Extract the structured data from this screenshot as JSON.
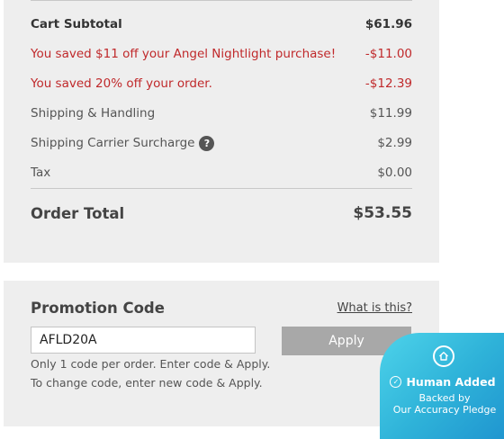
{
  "summary": {
    "subtotal": {
      "label": "Cart Subtotal",
      "value": "$61.96"
    },
    "discounts": [
      {
        "label": "You saved $11 off your Angel Nightlight purchase!",
        "value": "-$11.00"
      },
      {
        "label": "You saved 20% off your order.",
        "value": "-$12.39"
      }
    ],
    "shipping": {
      "label": "Shipping & Handling",
      "value": "$11.99"
    },
    "surcharge": {
      "label": "Shipping Carrier Surcharge",
      "value": "$2.99",
      "help_glyph": "?"
    },
    "tax": {
      "label": "Tax",
      "value": "$0.00"
    },
    "total": {
      "label": "Order Total",
      "value": "$53.55"
    }
  },
  "promo": {
    "title": "Promotion Code",
    "help_link": "What is this?",
    "code_value": "AFLD20A",
    "apply_label": "Apply",
    "note_line1": "Only 1 code per order. Enter code & Apply.",
    "note_line2": "To change code, enter new code & Apply."
  },
  "badge": {
    "headline": "Human Added",
    "line1": "Backed by",
    "line2": "Our Accuracy Pledge",
    "icon": "home-circle-icon",
    "check_icon": "check-circle-icon"
  },
  "colors": {
    "panel_bg": "#eeeeee",
    "discount_red": "#c0292b",
    "apply_button": "#a8a8a8",
    "badge_teal": "#2fb3d9"
  }
}
